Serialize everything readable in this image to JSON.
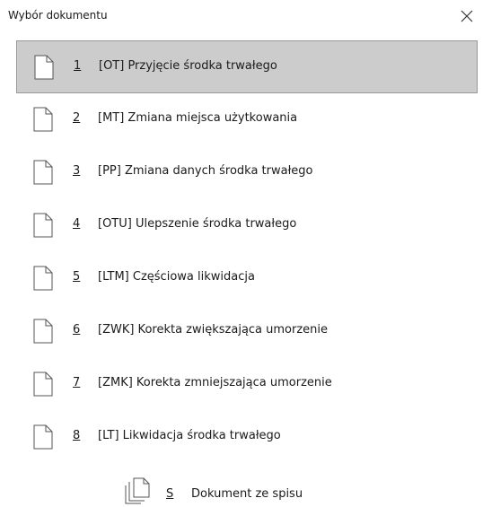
{
  "dialog": {
    "title": "Wybór dokumentu",
    "close_icon": "close-icon"
  },
  "documents": [
    {
      "number": "1",
      "label": "[OT] Przyjęcie środka trwałego",
      "selected": true
    },
    {
      "number": "2",
      "label": "[MT] Zmiana miejsca użytkowania",
      "selected": false
    },
    {
      "number": "3",
      "label": "[PP] Zmiana danych środka trwałego",
      "selected": false
    },
    {
      "number": "4",
      "label": "[OTU] Ulepszenie środka trwałego",
      "selected": false
    },
    {
      "number": "5",
      "label": "[LTM] Częściowa likwidacja",
      "selected": false
    },
    {
      "number": "6",
      "label": "[ZWK] Korekta zwiększająca umorzenie",
      "selected": false
    },
    {
      "number": "7",
      "label": "[ZMK] Korekta zmniejszająca umorzenie",
      "selected": false
    },
    {
      "number": "8",
      "label": "[LT] Likwidacja środka trwałego",
      "selected": false
    }
  ],
  "extra_option": {
    "shortcut": "S",
    "label": "Dokument ze spisu",
    "icon": "documents-list-icon"
  },
  "colors": {
    "selected_bg": "#cccccc",
    "selected_border": "#999999"
  }
}
